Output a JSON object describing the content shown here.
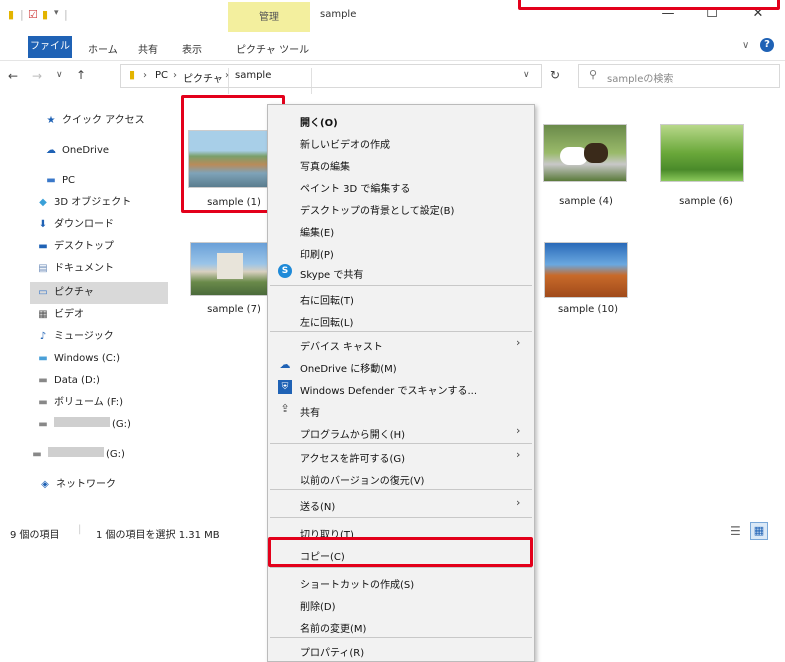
{
  "window": {
    "title": "sample",
    "manage_tab": "管理",
    "controls": {
      "minimize": "—",
      "maximize": "☐",
      "close": "✕"
    }
  },
  "ribbon": {
    "file": "ファイル",
    "home": "ホーム",
    "share": "共有",
    "view": "表示",
    "picture_tools": "ピクチャ ツール"
  },
  "address": {
    "path": [
      "PC",
      "ピクチャ",
      "sample"
    ],
    "search_placeholder": "sampleの検索"
  },
  "sidebar": {
    "items": [
      {
        "label": "クイック アクセス",
        "icon": "star-icon"
      },
      {
        "label": "OneDrive",
        "icon": "cloud-icon"
      },
      {
        "label": "PC",
        "icon": "pc-icon"
      },
      {
        "label": "3D オブジェクト",
        "icon": "cube-icon"
      },
      {
        "label": "ダウンロード",
        "icon": "download-icon"
      },
      {
        "label": "デスクトップ",
        "icon": "desktop-icon"
      },
      {
        "label": "ドキュメント",
        "icon": "document-icon"
      },
      {
        "label": "ピクチャ",
        "icon": "pictures-icon"
      },
      {
        "label": "ビデオ",
        "icon": "video-icon"
      },
      {
        "label": "ミュージック",
        "icon": "music-icon"
      },
      {
        "label": "Windows (C:)",
        "icon": "drive-icon"
      },
      {
        "label": "Data (D:)",
        "icon": "drive-icon"
      },
      {
        "label": "ボリューム (F:)",
        "icon": "drive-icon"
      },
      {
        "label": "(G:)",
        "icon": "drive-icon"
      },
      {
        "label": "(G:)",
        "icon": "drive-icon"
      },
      {
        "label": "ネットワーク",
        "icon": "network-icon"
      }
    ]
  },
  "files": [
    {
      "name": "sample (1)"
    },
    {
      "name": "sample (4)"
    },
    {
      "name": "sample (6)"
    },
    {
      "name": "sample (7)"
    },
    {
      "name": "sample (10)"
    }
  ],
  "status": {
    "count": "9 個の項目",
    "selected": "1 個の項目を選択  1.31 MB"
  },
  "context_menu": {
    "items": [
      {
        "label": "開く(O)"
      },
      {
        "label": "新しいビデオの作成"
      },
      {
        "label": "写真の編集"
      },
      {
        "label": "ペイント 3D で編集する"
      },
      {
        "label": "デスクトップの背景として設定(B)"
      },
      {
        "label": "編集(E)"
      },
      {
        "label": "印刷(P)"
      },
      {
        "label": "Skype で共有"
      },
      {
        "label": "右に回転(T)"
      },
      {
        "label": "左に回転(L)"
      },
      {
        "label": "デバイス キャスト"
      },
      {
        "label": "OneDrive に移動(M)"
      },
      {
        "label": "Windows Defender でスキャンする..."
      },
      {
        "label": "共有"
      },
      {
        "label": "プログラムから開く(H)"
      },
      {
        "label": "アクセスを許可する(G)"
      },
      {
        "label": "以前のバージョンの復元(V)"
      },
      {
        "label": "送る(N)"
      },
      {
        "label": "切り取り(T)"
      },
      {
        "label": "コピー(C)"
      },
      {
        "label": "ショートカットの作成(S)"
      },
      {
        "label": "削除(D)"
      },
      {
        "label": "名前の変更(M)"
      },
      {
        "label": "プロパティ(R)"
      }
    ]
  },
  "colors": {
    "highlight": "#e3001b",
    "accent": "#1f62b5",
    "manage": "#f3ef9e"
  }
}
